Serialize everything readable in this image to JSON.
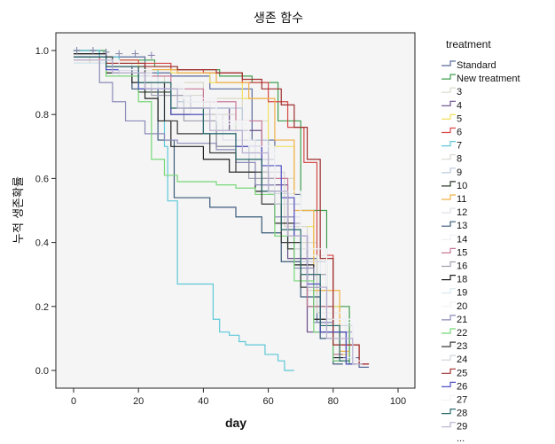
{
  "chart_data": {
    "type": "line",
    "subtype": "kaplan-meier-step",
    "title": "생존 함수",
    "xlabel": "day",
    "ylabel": "누적 생존확률",
    "xlim": [
      -5,
      105
    ],
    "ylim": [
      -0.055,
      1.055
    ],
    "xticks": [
      0,
      20,
      40,
      60,
      80,
      100
    ],
    "yticks": [
      0.0,
      0.2,
      0.4,
      0.6,
      0.8,
      1.0
    ],
    "ytick_labels": [
      "0.0",
      "0.2",
      "0.4",
      "0.6",
      "0.8",
      "1.0"
    ],
    "grid": false,
    "legend": {
      "title": "treatment",
      "position": "right",
      "overflow_text": "..."
    },
    "series": [
      {
        "name": "Standard",
        "color": "#5a6a9a",
        "x": [
          0,
          8,
          22,
          30,
          42,
          55,
          62,
          70,
          75,
          80,
          88
        ],
        "y": [
          1.0,
          0.98,
          0.93,
          0.92,
          0.88,
          0.72,
          0.55,
          0.35,
          0.15,
          0.04,
          0.01
        ]
      },
      {
        "name": "New treatment",
        "color": "#3f9f4f",
        "x": [
          0,
          10,
          25,
          32,
          45,
          55,
          63,
          70,
          78,
          85
        ],
        "y": [
          1.0,
          0.97,
          0.95,
          0.94,
          0.92,
          0.9,
          0.78,
          0.5,
          0.2,
          0.02
        ]
      },
      {
        "name": "3",
        "color": "#d9d9c8",
        "x": [
          0,
          5,
          18,
          28,
          40,
          52,
          60,
          68,
          75,
          82
        ],
        "y": [
          0.98,
          0.96,
          0.92,
          0.9,
          0.85,
          0.78,
          0.6,
          0.4,
          0.18,
          0.05
        ]
      },
      {
        "name": "4",
        "color": "#6a4f8a",
        "x": [
          0,
          12,
          20,
          28,
          36,
          48,
          58,
          66,
          72,
          80
        ],
        "y": [
          0.97,
          0.94,
          0.9,
          0.86,
          0.82,
          0.75,
          0.58,
          0.35,
          0.12,
          0.03
        ]
      },
      {
        "name": "5",
        "color": "#f2e060",
        "x": [
          0,
          10,
          20,
          30,
          42,
          52,
          60,
          68,
          74,
          82
        ],
        "y": [
          0.98,
          0.97,
          0.95,
          0.93,
          0.9,
          0.85,
          0.7,
          0.45,
          0.2,
          0.05
        ]
      },
      {
        "name": "6",
        "color": "#d64848",
        "x": [
          0,
          8,
          20,
          30,
          40,
          52,
          60,
          66,
          71,
          75,
          80,
          88
        ],
        "y": [
          0.98,
          0.97,
          0.96,
          0.94,
          0.93,
          0.9,
          0.84,
          0.76,
          0.65,
          0.36,
          0.08,
          0.02
        ]
      },
      {
        "name": "7",
        "color": "#5ec8d8",
        "x": [
          0,
          8,
          14,
          22,
          26,
          28,
          29,
          32,
          43,
          45,
          48,
          51,
          53,
          59,
          63,
          65
        ],
        "y": [
          1.0,
          0.98,
          0.96,
          0.94,
          0.88,
          0.7,
          0.53,
          0.27,
          0.16,
          0.12,
          0.11,
          0.09,
          0.08,
          0.05,
          0.03,
          0.0
        ]
      },
      {
        "name": "8",
        "color": "#d8d8d0",
        "x": [
          0,
          10,
          20,
          30,
          40,
          50,
          58,
          65,
          72,
          80
        ],
        "y": [
          0.97,
          0.94,
          0.9,
          0.86,
          0.8,
          0.72,
          0.62,
          0.45,
          0.25,
          0.08
        ]
      },
      {
        "name": "9",
        "color": "#b8c8dc",
        "x": [
          0,
          12,
          24,
          32,
          42,
          52,
          60,
          68,
          76,
          84
        ],
        "y": [
          0.97,
          0.93,
          0.88,
          0.84,
          0.82,
          0.72,
          0.55,
          0.38,
          0.16,
          0.04
        ]
      },
      {
        "name": "10",
        "color": "#2a3a2a",
        "x": [
          0,
          10,
          20,
          30,
          44,
          54,
          60,
          66,
          72,
          80
        ],
        "y": [
          0.99,
          0.95,
          0.87,
          0.8,
          0.7,
          0.62,
          0.55,
          0.38,
          0.2,
          0.05
        ]
      },
      {
        "name": "11",
        "color": "#f0b048",
        "x": [
          0,
          10,
          22,
          32,
          44,
          54,
          62,
          68,
          74,
          82
        ],
        "y": [
          0.98,
          0.96,
          0.94,
          0.93,
          0.9,
          0.85,
          0.72,
          0.5,
          0.25,
          0.06
        ]
      },
      {
        "name": "12",
        "color": "#e0e0e8",
        "x": [
          0,
          14,
          26,
          36,
          46,
          56,
          64,
          70,
          78,
          86
        ],
        "y": [
          0.96,
          0.92,
          0.86,
          0.8,
          0.72,
          0.62,
          0.48,
          0.3,
          0.12,
          0.02
        ]
      },
      {
        "name": "13",
        "color": "#3a5a7a",
        "x": [
          0,
          10,
          18,
          26,
          31,
          42,
          50,
          58,
          64,
          70,
          76,
          80
        ],
        "y": [
          0.98,
          0.95,
          0.88,
          0.72,
          0.54,
          0.51,
          0.48,
          0.43,
          0.34,
          0.23,
          0.1,
          0.02
        ]
      },
      {
        "name": "14",
        "color": "#eef0f4",
        "x": [
          0,
          12,
          22,
          32,
          42,
          52,
          60,
          68,
          76,
          84
        ],
        "y": [
          0.97,
          0.94,
          0.9,
          0.85,
          0.78,
          0.68,
          0.55,
          0.38,
          0.18,
          0.04
        ]
      },
      {
        "name": "15",
        "color": "#c87898",
        "x": [
          0,
          10,
          20,
          30,
          40,
          50,
          58,
          66,
          72,
          80
        ],
        "y": [
          0.98,
          0.95,
          0.92,
          0.88,
          0.84,
          0.78,
          0.6,
          0.42,
          0.2,
          0.05
        ]
      },
      {
        "name": "16",
        "color": "#a0a0b0",
        "x": [
          0,
          14,
          24,
          34,
          44,
          54,
          62,
          70,
          78,
          86
        ],
        "y": [
          0.96,
          0.93,
          0.86,
          0.78,
          0.7,
          0.6,
          0.46,
          0.3,
          0.12,
          0.03
        ]
      },
      {
        "name": "18",
        "color": "#202020",
        "x": [
          0,
          10,
          18,
          22,
          26,
          30,
          40,
          48,
          56,
          62,
          68,
          74,
          80
        ],
        "y": [
          0.99,
          0.93,
          0.9,
          0.85,
          0.78,
          0.7,
          0.66,
          0.62,
          0.56,
          0.46,
          0.33,
          0.16,
          0.04
        ]
      },
      {
        "name": "19",
        "color": "#d8e8f0",
        "x": [
          0,
          12,
          24,
          34,
          44,
          54,
          62,
          70,
          78,
          86
        ],
        "y": [
          0.96,
          0.92,
          0.88,
          0.82,
          0.75,
          0.66,
          0.52,
          0.34,
          0.14,
          0.02
        ]
      },
      {
        "name": "20",
        "color": "#f0f2f4",
        "x": [
          0,
          14,
          24,
          34,
          44,
          54,
          62,
          70,
          78,
          86
        ],
        "y": [
          0.97,
          0.93,
          0.89,
          0.84,
          0.77,
          0.68,
          0.54,
          0.36,
          0.15,
          0.03
        ]
      },
      {
        "name": "21",
        "color": "#8a8ab8",
        "x": [
          0,
          8,
          12,
          16,
          22,
          28,
          32,
          44,
          50,
          56,
          62,
          68,
          74,
          80
        ],
        "y": [
          0.97,
          0.9,
          0.84,
          0.78,
          0.74,
          0.72,
          0.71,
          0.69,
          0.65,
          0.58,
          0.48,
          0.32,
          0.15,
          0.03
        ]
      },
      {
        "name": "22",
        "color": "#78d878",
        "x": [
          0,
          10,
          20,
          24,
          28,
          32,
          44,
          50,
          56,
          62,
          68,
          74,
          80
        ],
        "y": [
          0.98,
          0.92,
          0.84,
          0.66,
          0.61,
          0.59,
          0.58,
          0.57,
          0.55,
          0.42,
          0.28,
          0.12,
          0.03
        ]
      },
      {
        "name": "23",
        "color": "#3a3a3a",
        "x": [
          0,
          12,
          22,
          28,
          32,
          42,
          50,
          58,
          64,
          70,
          76,
          84
        ],
        "y": [
          0.98,
          0.95,
          0.9,
          0.78,
          0.74,
          0.68,
          0.62,
          0.52,
          0.4,
          0.26,
          0.12,
          0.02
        ]
      },
      {
        "name": "24",
        "color": "#d0d4dc",
        "x": [
          0,
          14,
          24,
          34,
          44,
          54,
          62,
          70,
          78,
          86
        ],
        "y": [
          0.97,
          0.93,
          0.88,
          0.82,
          0.75,
          0.66,
          0.52,
          0.34,
          0.14,
          0.03
        ]
      },
      {
        "name": "25",
        "color": "#a03030",
        "x": [
          0,
          10,
          22,
          32,
          44,
          52,
          58,
          64,
          68,
          72,
          76,
          80,
          88
        ],
        "y": [
          0.97,
          0.96,
          0.95,
          0.94,
          0.93,
          0.91,
          0.88,
          0.83,
          0.76,
          0.66,
          0.35,
          0.08,
          0.02
        ]
      },
      {
        "name": "26",
        "color": "#5050c8",
        "x": [
          0,
          10,
          20,
          30,
          40,
          50,
          58,
          64,
          68,
          72,
          76,
          84
        ],
        "y": [
          0.98,
          0.94,
          0.88,
          0.8,
          0.74,
          0.7,
          0.64,
          0.54,
          0.42,
          0.27,
          0.12,
          0.02
        ]
      },
      {
        "name": "27",
        "color": "#f4f4f8",
        "x": [
          0,
          14,
          24,
          34,
          44,
          54,
          62,
          70,
          78,
          86
        ],
        "y": [
          0.97,
          0.94,
          0.9,
          0.85,
          0.78,
          0.7,
          0.56,
          0.38,
          0.16,
          0.03
        ]
      },
      {
        "name": "28",
        "color": "#2a6a6a",
        "x": [
          0,
          10,
          20,
          30,
          40,
          50,
          58,
          64,
          70,
          76,
          82
        ],
        "y": [
          0.98,
          0.95,
          0.9,
          0.82,
          0.74,
          0.66,
          0.56,
          0.44,
          0.3,
          0.14,
          0.03
        ]
      },
      {
        "name": "29",
        "color": "#b8b0d0",
        "x": [
          0,
          12,
          22,
          32,
          42,
          52,
          60,
          66,
          72,
          78,
          86
        ],
        "y": [
          0.97,
          0.93,
          0.88,
          0.82,
          0.75,
          0.68,
          0.56,
          0.42,
          0.26,
          0.1,
          0.02
        ]
      }
    ]
  }
}
